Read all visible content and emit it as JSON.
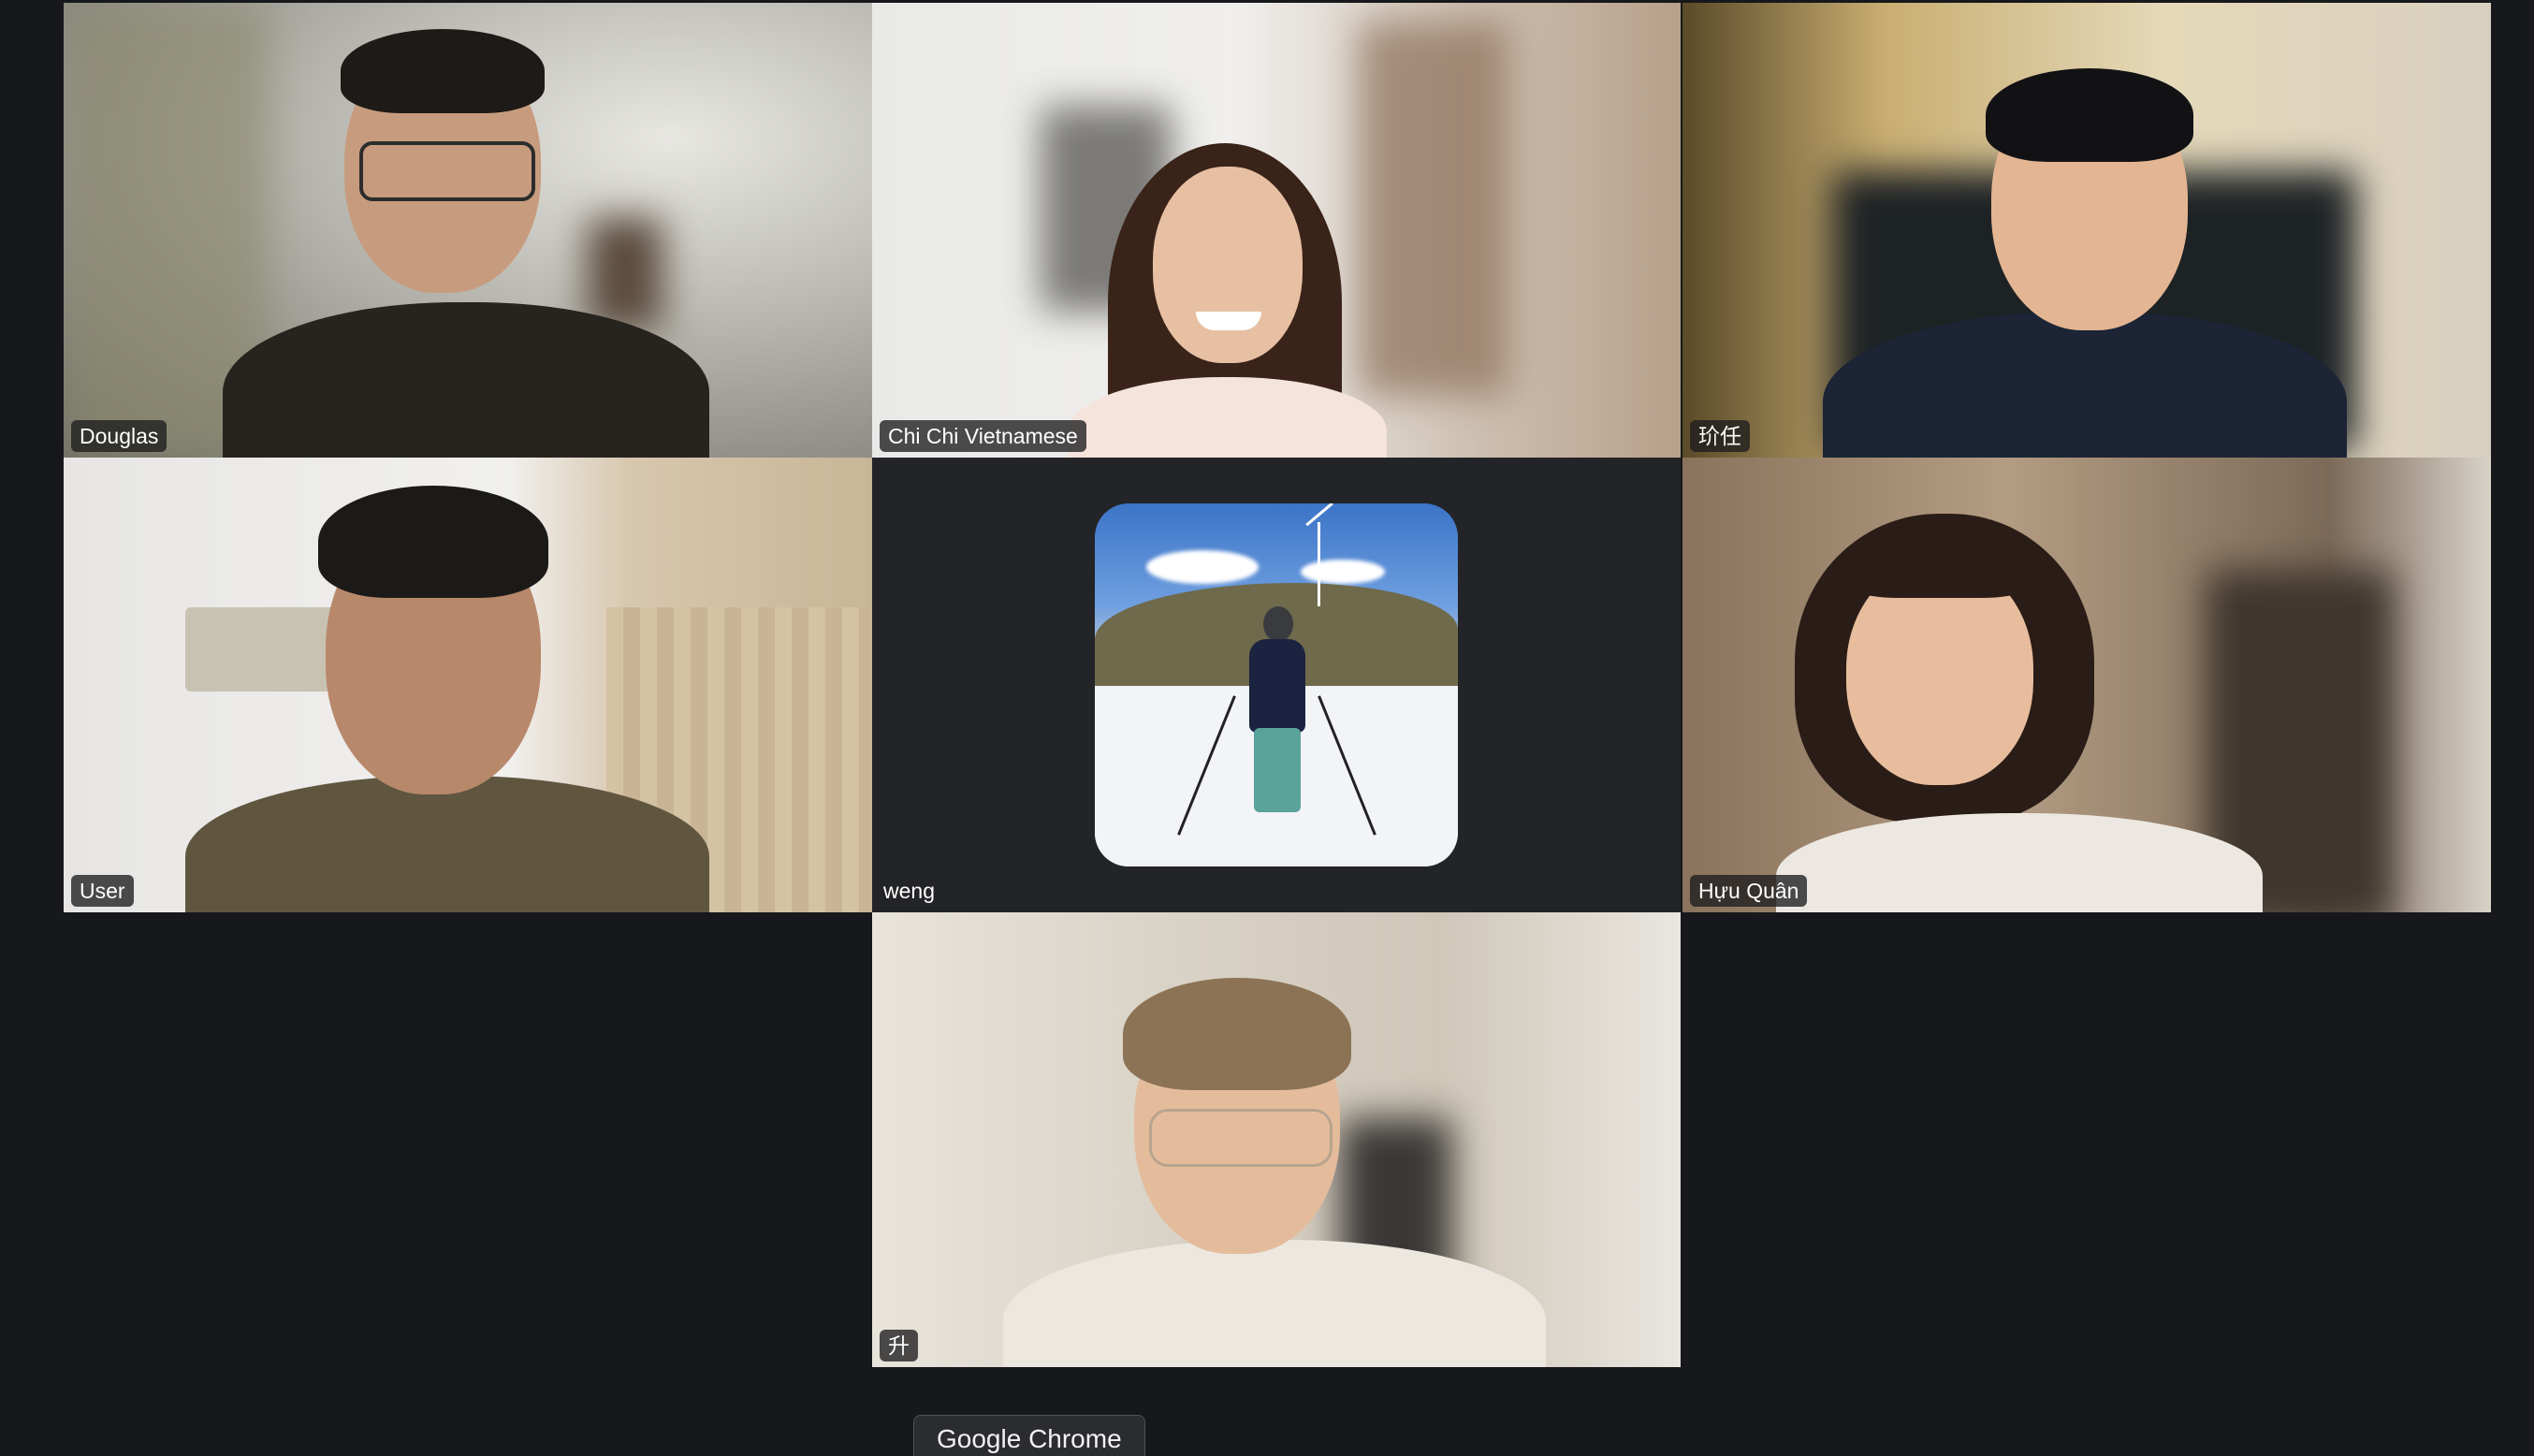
{
  "participants": [
    {
      "name": "Douglas"
    },
    {
      "name": "Chi Chi Vietnamese",
      "speaking": true
    },
    {
      "name": "玠任"
    },
    {
      "name": "User"
    },
    {
      "name": "weng",
      "video_off": true,
      "avatar": "skier-photo"
    },
    {
      "name": "Hựu Quân"
    },
    {
      "name": "升"
    }
  ],
  "colors": {
    "background": "#17181b",
    "active_speaker_border": "#3fae49",
    "label_background": "#1c1c1e"
  },
  "dock_tooltip": {
    "label": "Google Chrome"
  }
}
